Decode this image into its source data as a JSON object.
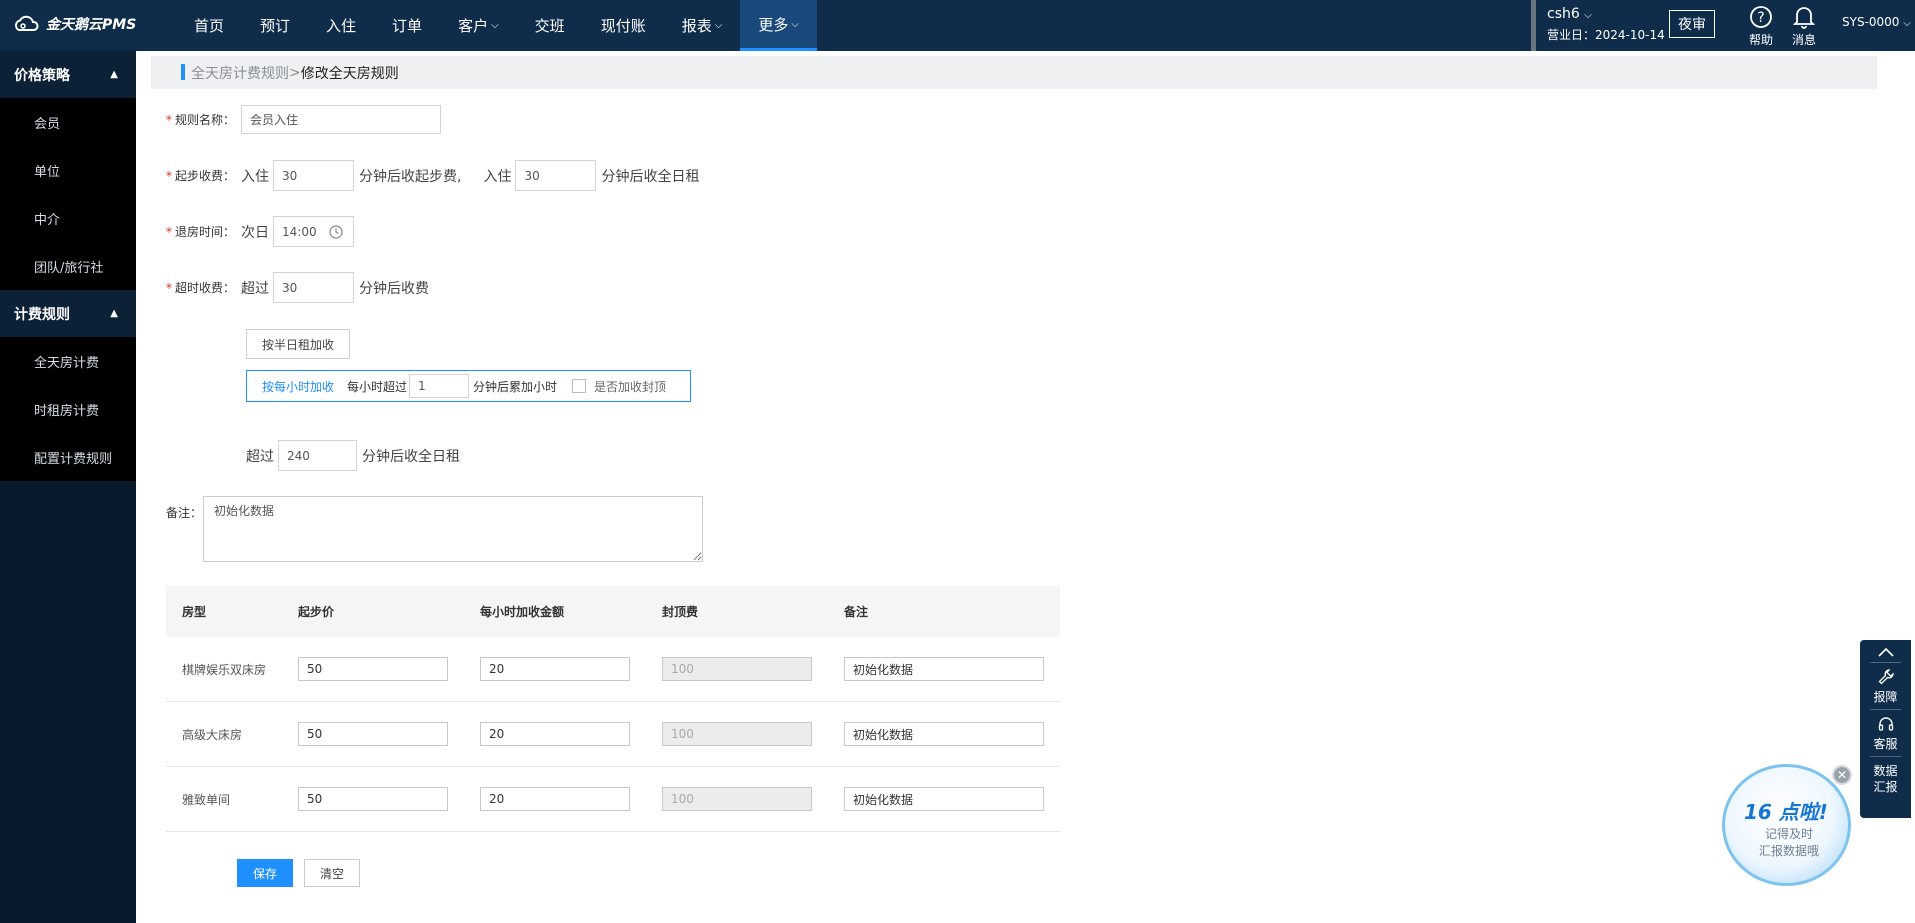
{
  "app": {
    "logo_text": "金天鹅云PMS"
  },
  "nav": {
    "items": [
      {
        "label": "首页",
        "has_dropdown": false
      },
      {
        "label": "预订",
        "has_dropdown": false
      },
      {
        "label": "入住",
        "has_dropdown": false
      },
      {
        "label": "订单",
        "has_dropdown": false
      },
      {
        "label": "客户",
        "has_dropdown": true
      },
      {
        "label": "交班",
        "has_dropdown": false
      },
      {
        "label": "现付账",
        "has_dropdown": false
      },
      {
        "label": "报表",
        "has_dropdown": true
      },
      {
        "label": "更多",
        "has_dropdown": true,
        "active": true
      }
    ],
    "chevron": "⌵"
  },
  "header": {
    "user": "csh6",
    "biz_date_label": "营业日：",
    "biz_date": "2024-10-14",
    "night_audit": "夜审",
    "help": "帮助",
    "messages": "消息",
    "sys_user": "SYS-0000"
  },
  "sidebar": {
    "groups": [
      {
        "title": "价格策略",
        "items": [
          "会员",
          "单位",
          "中介",
          "团队/旅行社"
        ]
      },
      {
        "title": "计费规则",
        "items": [
          "全天房计费",
          "时租房计费",
          "配置计费规则"
        ]
      }
    ]
  },
  "breadcrumb": {
    "parent": "全天房计费规则",
    "separator": ">",
    "current": "修改全天房规则"
  },
  "form": {
    "rule_name": {
      "label": "规则名称：",
      "value": "会员入住"
    },
    "start_fee": {
      "label": "起步收费：",
      "prefix1": "入住",
      "value1": "30",
      "suffix1": "分钟后收起步费,",
      "prefix2": "入住",
      "value2": "30",
      "suffix2": "分钟后收全日租"
    },
    "checkout": {
      "label": "退房时间：",
      "prefix": "次日",
      "value": "14:00"
    },
    "overtime": {
      "label": "超时收费：",
      "prefix": "超过",
      "value": "30",
      "suffix": "分钟后收费"
    },
    "half_day_button": "按半日租加收",
    "hourly": {
      "button": "按每小时加收",
      "text1": "每小时超过",
      "value": "1",
      "text2": "分钟后累加小时",
      "cap_label": "是否加收封顶"
    },
    "full_day": {
      "prefix": "超过",
      "value": "240",
      "suffix": "分钟后收全日租"
    },
    "remark": {
      "label": "备注：",
      "value": "初始化数据"
    }
  },
  "table": {
    "headers": [
      "房型",
      "起步价",
      "每小时加收金额",
      "封顶费",
      "备注"
    ],
    "rows": [
      {
        "room_type": "棋牌娱乐双床房",
        "start_price": "50",
        "hourly": "20",
        "cap": "100",
        "remark": "初始化数据"
      },
      {
        "room_type": "高级大床房",
        "start_price": "50",
        "hourly": "20",
        "cap": "100",
        "remark": "初始化数据"
      },
      {
        "room_type": "雅致单间",
        "start_price": "50",
        "hourly": "20",
        "cap": "100",
        "remark": "初始化数据"
      }
    ]
  },
  "actions": {
    "save": "保存",
    "clear": "清空"
  },
  "float_bar": {
    "report": "报障",
    "service": "客服",
    "data_line1": "数据",
    "data_line2": "汇报"
  },
  "promo": {
    "title": "16 点啦!",
    "line1": "记得及时",
    "line2": "汇报数据哦"
  },
  "colors": {
    "nav_bg": "#0f2d4b",
    "sidebar_bg": "#081a2b",
    "accent": "#1e90ff",
    "required": "#e52b2b"
  }
}
